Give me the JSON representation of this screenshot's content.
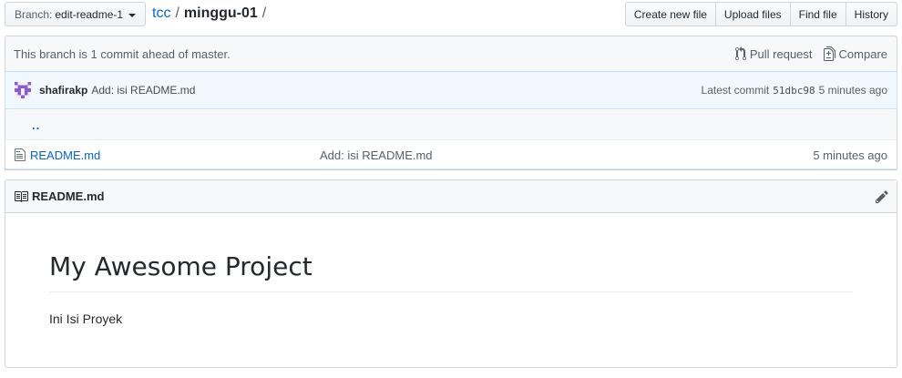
{
  "branch_selector": {
    "prefix": "Branch:",
    "name": "edit-readme-1"
  },
  "breadcrumb": {
    "repo": "tcc",
    "separator": "/",
    "directory": "minggu-01",
    "trailing_separator": "/"
  },
  "file_nav": {
    "create": "Create new file",
    "upload": "Upload files",
    "find": "Find file",
    "history": "History"
  },
  "branch_info": {
    "message": "This branch is 1 commit ahead of master.",
    "pull_request": "Pull request",
    "compare": "Compare"
  },
  "commit": {
    "author": "shafirakp",
    "message": "Add: isi README.md",
    "latest_label": "Latest commit",
    "sha": "51dbc98",
    "age": "5 minutes ago"
  },
  "files": {
    "up_dir": "..",
    "rows": [
      {
        "name": "README.md",
        "message": "Add: isi README.md",
        "age": "5 minutes ago"
      }
    ]
  },
  "readme": {
    "filename": "README.md",
    "heading": "My Awesome Project",
    "body": "Ini Isi Proyek"
  },
  "colors": {
    "link": "#0366d6",
    "avatar": "#8c5ad6",
    "commit_bg": "#f1f8ff"
  }
}
